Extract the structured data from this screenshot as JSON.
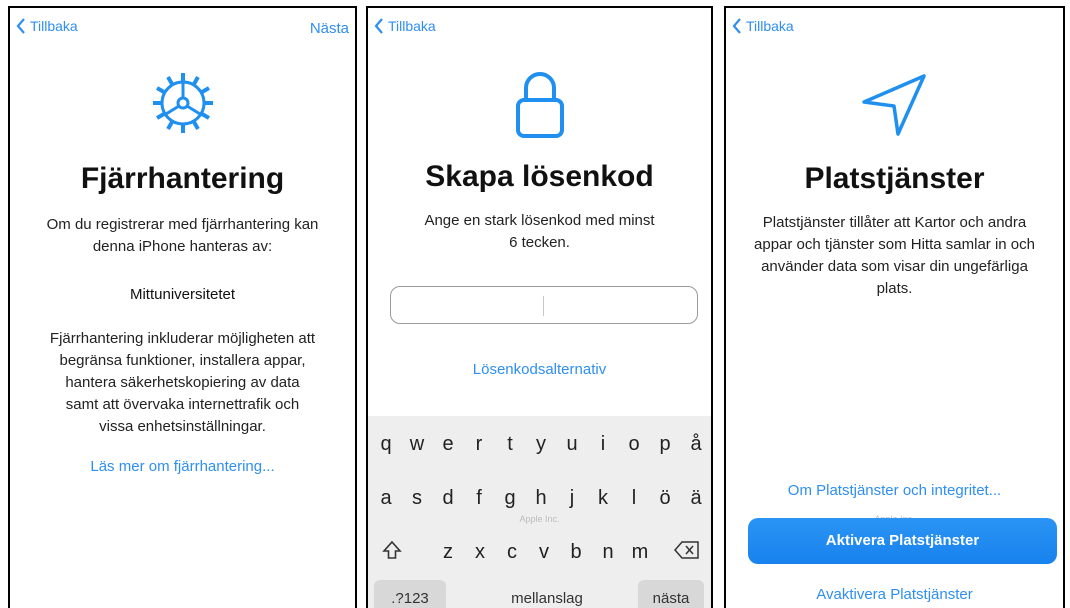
{
  "colors": {
    "accent": "#2f8ff0",
    "button": "#1f88f0"
  },
  "screen1": {
    "back_label": "Tillbaka",
    "next_label": "Nästa",
    "icon": "gear-icon",
    "title": "Fjärrhantering",
    "intro_line1": "Om du registrerar med fjärrhantering kan",
    "intro_line2": "denna iPhone hanteras av:",
    "organization": "Mittuniversitetet",
    "desc_line1": "Fjärrhantering inkluderar möjligheten att",
    "desc_line2": "begränsa funktioner, installera appar,",
    "desc_line3": "hantera säkerhetskopiering av data",
    "desc_line4": "samt att övervaka internettrafik och",
    "desc_line5": "vissa enhetsinställningar.",
    "learn_more_link": "Läs mer om fjärrhantering..."
  },
  "screen2": {
    "back_label": "Tillbaka",
    "icon": "lock-icon",
    "title": "Skapa lösenkod",
    "instruction_line1": "Ange en stark lösenkod med minst",
    "instruction_line2": "6 tecken.",
    "passcode_value": "",
    "options_link": "Lösenkodsalternativ",
    "footer_faint": "Apple Inc.",
    "keyboard": {
      "row1": [
        "q",
        "w",
        "e",
        "r",
        "t",
        "y",
        "u",
        "i",
        "o",
        "p",
        "å"
      ],
      "row2": [
        "a",
        "s",
        "d",
        "f",
        "g",
        "h",
        "j",
        "k",
        "l",
        "ö",
        "ä"
      ],
      "row3": [
        "z",
        "x",
        "c",
        "v",
        "b",
        "n",
        "m"
      ],
      "numbers_key": ".?123",
      "space_key": "mellanslag",
      "return_key": "nästa",
      "shift_icon": "shift-icon",
      "delete_icon": "delete-icon"
    }
  },
  "screen3": {
    "back_label": "Tillbaka",
    "icon": "location-arrow-icon",
    "title": "Platstjänster",
    "desc_line1": "Platstjänster tillåter att Kartor och andra",
    "desc_line2": "appar och tjänster som Hitta samlar in och",
    "desc_line3": "använder data som visar din ungefärliga",
    "desc_line4": "plats.",
    "privacy_link": "Om Platstjänster och integritet...",
    "footer_faint": "Apple Inc.",
    "enable_button": "Aktivera Platstjänster",
    "disable_button": "Avaktivera Platstjänster"
  }
}
